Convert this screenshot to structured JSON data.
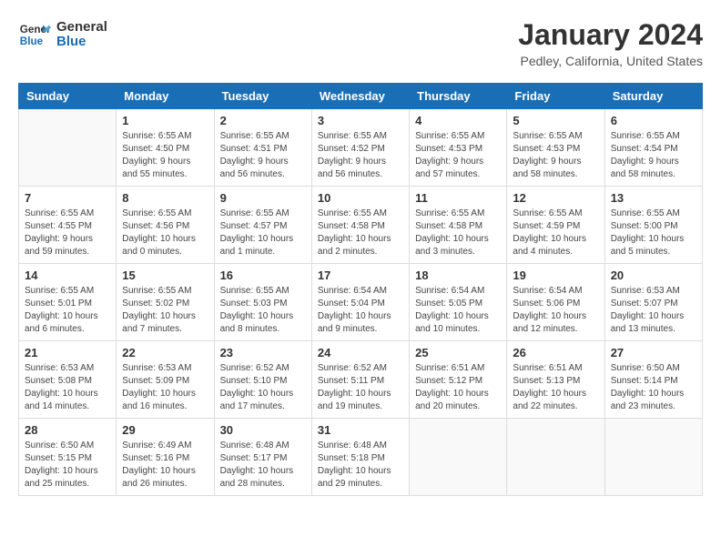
{
  "header": {
    "logo_line1": "General",
    "logo_line2": "Blue",
    "title": "January 2024",
    "location": "Pedley, California, United States"
  },
  "weekdays": [
    "Sunday",
    "Monday",
    "Tuesday",
    "Wednesday",
    "Thursday",
    "Friday",
    "Saturday"
  ],
  "weeks": [
    [
      {
        "day": "",
        "info": ""
      },
      {
        "day": "1",
        "info": "Sunrise: 6:55 AM\nSunset: 4:50 PM\nDaylight: 9 hours\nand 55 minutes."
      },
      {
        "day": "2",
        "info": "Sunrise: 6:55 AM\nSunset: 4:51 PM\nDaylight: 9 hours\nand 56 minutes."
      },
      {
        "day": "3",
        "info": "Sunrise: 6:55 AM\nSunset: 4:52 PM\nDaylight: 9 hours\nand 56 minutes."
      },
      {
        "day": "4",
        "info": "Sunrise: 6:55 AM\nSunset: 4:53 PM\nDaylight: 9 hours\nand 57 minutes."
      },
      {
        "day": "5",
        "info": "Sunrise: 6:55 AM\nSunset: 4:53 PM\nDaylight: 9 hours\nand 58 minutes."
      },
      {
        "day": "6",
        "info": "Sunrise: 6:55 AM\nSunset: 4:54 PM\nDaylight: 9 hours\nand 58 minutes."
      }
    ],
    [
      {
        "day": "7",
        "info": "Sunrise: 6:55 AM\nSunset: 4:55 PM\nDaylight: 9 hours\nand 59 minutes."
      },
      {
        "day": "8",
        "info": "Sunrise: 6:55 AM\nSunset: 4:56 PM\nDaylight: 10 hours\nand 0 minutes."
      },
      {
        "day": "9",
        "info": "Sunrise: 6:55 AM\nSunset: 4:57 PM\nDaylight: 10 hours\nand 1 minute."
      },
      {
        "day": "10",
        "info": "Sunrise: 6:55 AM\nSunset: 4:58 PM\nDaylight: 10 hours\nand 2 minutes."
      },
      {
        "day": "11",
        "info": "Sunrise: 6:55 AM\nSunset: 4:58 PM\nDaylight: 10 hours\nand 3 minutes."
      },
      {
        "day": "12",
        "info": "Sunrise: 6:55 AM\nSunset: 4:59 PM\nDaylight: 10 hours\nand 4 minutes."
      },
      {
        "day": "13",
        "info": "Sunrise: 6:55 AM\nSunset: 5:00 PM\nDaylight: 10 hours\nand 5 minutes."
      }
    ],
    [
      {
        "day": "14",
        "info": "Sunrise: 6:55 AM\nSunset: 5:01 PM\nDaylight: 10 hours\nand 6 minutes."
      },
      {
        "day": "15",
        "info": "Sunrise: 6:55 AM\nSunset: 5:02 PM\nDaylight: 10 hours\nand 7 minutes."
      },
      {
        "day": "16",
        "info": "Sunrise: 6:55 AM\nSunset: 5:03 PM\nDaylight: 10 hours\nand 8 minutes."
      },
      {
        "day": "17",
        "info": "Sunrise: 6:54 AM\nSunset: 5:04 PM\nDaylight: 10 hours\nand 9 minutes."
      },
      {
        "day": "18",
        "info": "Sunrise: 6:54 AM\nSunset: 5:05 PM\nDaylight: 10 hours\nand 10 minutes."
      },
      {
        "day": "19",
        "info": "Sunrise: 6:54 AM\nSunset: 5:06 PM\nDaylight: 10 hours\nand 12 minutes."
      },
      {
        "day": "20",
        "info": "Sunrise: 6:53 AM\nSunset: 5:07 PM\nDaylight: 10 hours\nand 13 minutes."
      }
    ],
    [
      {
        "day": "21",
        "info": "Sunrise: 6:53 AM\nSunset: 5:08 PM\nDaylight: 10 hours\nand 14 minutes."
      },
      {
        "day": "22",
        "info": "Sunrise: 6:53 AM\nSunset: 5:09 PM\nDaylight: 10 hours\nand 16 minutes."
      },
      {
        "day": "23",
        "info": "Sunrise: 6:52 AM\nSunset: 5:10 PM\nDaylight: 10 hours\nand 17 minutes."
      },
      {
        "day": "24",
        "info": "Sunrise: 6:52 AM\nSunset: 5:11 PM\nDaylight: 10 hours\nand 19 minutes."
      },
      {
        "day": "25",
        "info": "Sunrise: 6:51 AM\nSunset: 5:12 PM\nDaylight: 10 hours\nand 20 minutes."
      },
      {
        "day": "26",
        "info": "Sunrise: 6:51 AM\nSunset: 5:13 PM\nDaylight: 10 hours\nand 22 minutes."
      },
      {
        "day": "27",
        "info": "Sunrise: 6:50 AM\nSunset: 5:14 PM\nDaylight: 10 hours\nand 23 minutes."
      }
    ],
    [
      {
        "day": "28",
        "info": "Sunrise: 6:50 AM\nSunset: 5:15 PM\nDaylight: 10 hours\nand 25 minutes."
      },
      {
        "day": "29",
        "info": "Sunrise: 6:49 AM\nSunset: 5:16 PM\nDaylight: 10 hours\nand 26 minutes."
      },
      {
        "day": "30",
        "info": "Sunrise: 6:48 AM\nSunset: 5:17 PM\nDaylight: 10 hours\nand 28 minutes."
      },
      {
        "day": "31",
        "info": "Sunrise: 6:48 AM\nSunset: 5:18 PM\nDaylight: 10 hours\nand 29 minutes."
      },
      {
        "day": "",
        "info": ""
      },
      {
        "day": "",
        "info": ""
      },
      {
        "day": "",
        "info": ""
      }
    ]
  ]
}
